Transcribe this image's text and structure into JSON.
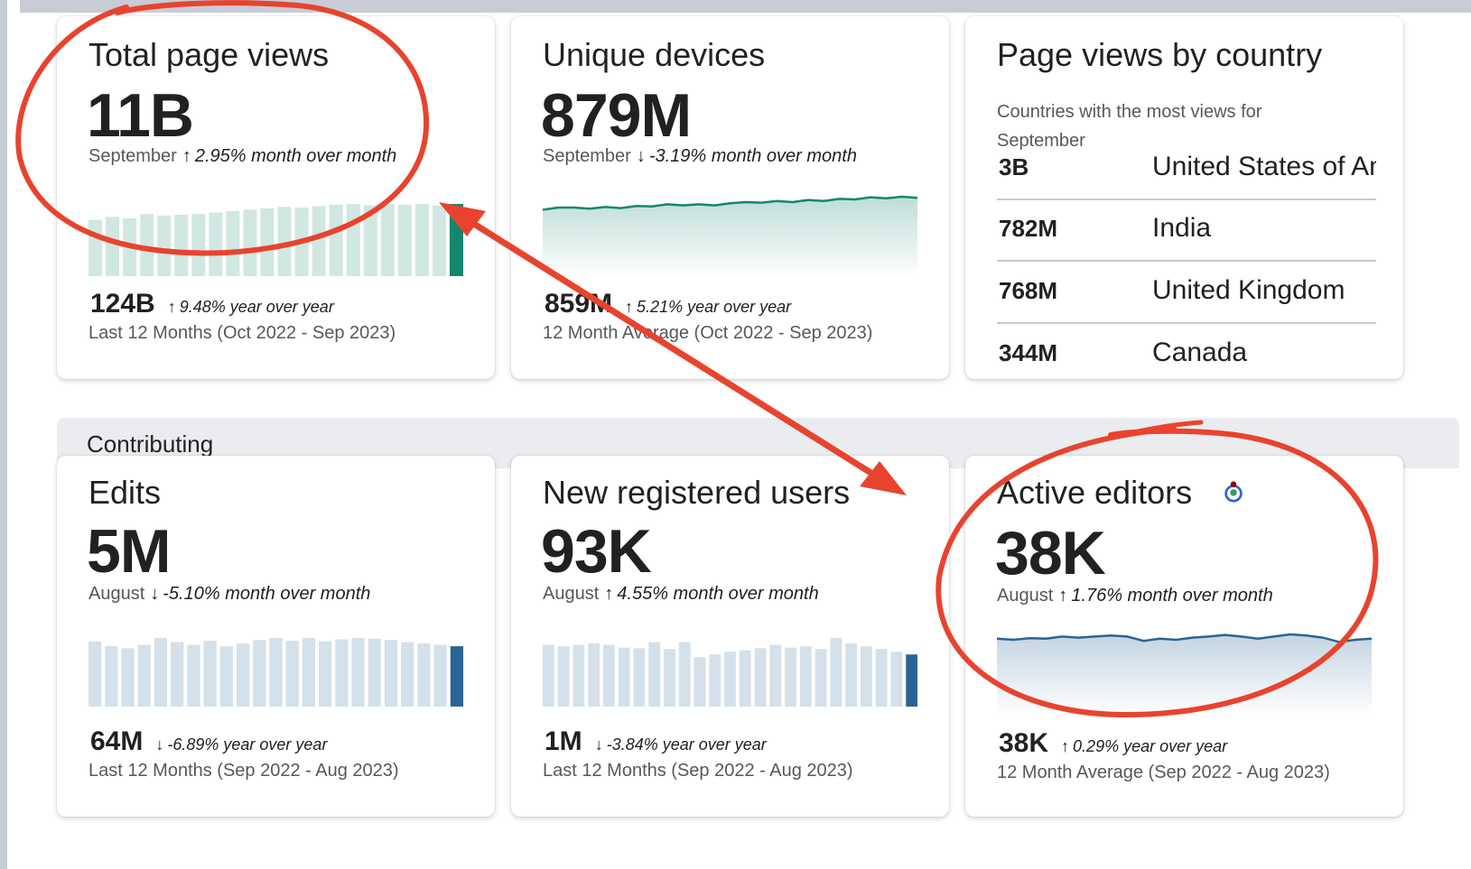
{
  "cards": {
    "page_views": {
      "title": "Total page views",
      "value": "11B",
      "period": "September",
      "change": "2.95% month over month",
      "footer_value": "124B",
      "footer_change": "9.48% year over year",
      "footer_range": "Last 12 Months (Oct 2022 - Sep 2023)",
      "color": "#14866d",
      "bars": [
        0.78,
        0.82,
        0.8,
        0.86,
        0.84,
        0.85,
        0.86,
        0.88,
        0.9,
        0.92,
        0.94,
        0.96,
        0.95,
        0.97,
        0.99,
        1.0,
        0.98,
        1.0,
        0.99,
        1.0,
        0.98,
        1.0
      ]
    },
    "devices": {
      "title": "Unique devices",
      "value": "879M",
      "period": "September",
      "change": "-3.19% month over month",
      "footer_value": "859M",
      "footer_change": "5.21% year over year",
      "footer_range": "12 Month Average (Oct 2022 - Sep 2023)",
      "color": "#14866d",
      "line": [
        0.76,
        0.8,
        0.8,
        0.78,
        0.81,
        0.79,
        0.83,
        0.82,
        0.86,
        0.84,
        0.86,
        0.84,
        0.88,
        0.9,
        0.89,
        0.92,
        0.9,
        0.94,
        0.92,
        0.96,
        0.95,
        0.99,
        0.97,
        1.0,
        0.98
      ]
    },
    "country": {
      "title": "Page views by country",
      "description": "Countries with the most views for September",
      "rows": [
        {
          "value": "3B",
          "name": "United States of America"
        },
        {
          "value": "782M",
          "name": "India"
        },
        {
          "value": "768M",
          "name": "United Kingdom"
        },
        {
          "value": "344M",
          "name": "Canada"
        }
      ]
    },
    "edits": {
      "title": "Edits",
      "value": "5M",
      "period": "August",
      "change": "-5.10% month over month",
      "footer_value": "64M",
      "footer_change": "-6.89% year over year",
      "footer_range": "Last 12 Months (Sep 2022 - Aug 2023)",
      "color": "#2a6496",
      "bars": [
        0.95,
        0.88,
        0.85,
        0.9,
        1.0,
        0.94,
        0.9,
        0.96,
        0.88,
        0.92,
        0.97,
        1.0,
        0.96,
        1.0,
        0.95,
        0.98,
        1.0,
        0.99,
        0.97,
        0.94,
        0.92,
        0.9,
        0.88
      ]
    },
    "new_users": {
      "title": "New registered users",
      "value": "93K",
      "period": "August",
      "change": "4.55% month over month",
      "footer_value": "1M",
      "footer_change": "-3.84% year over year",
      "footer_range": "Last 12 Months (Sep 2022 - Aug 2023)",
      "color": "#2a6496",
      "bars": [
        0.9,
        0.88,
        0.9,
        0.92,
        0.9,
        0.86,
        0.85,
        0.94,
        0.84,
        0.94,
        0.72,
        0.76,
        0.8,
        0.82,
        0.85,
        0.9,
        0.86,
        0.88,
        0.84,
        1.0,
        0.92,
        0.88,
        0.84,
        0.8,
        0.76
      ]
    },
    "active_editors": {
      "title": "Active editors",
      "value": "38K",
      "period": "August",
      "change": "1.76% month over month",
      "footer_value": "38K",
      "footer_change": "0.29% year over year",
      "footer_range": "12 Month Average (Sep 2022 - Aug 2023)",
      "color": "#2a6496",
      "line": [
        0.92,
        0.9,
        0.93,
        0.92,
        0.96,
        0.94,
        0.96,
        0.98,
        0.96,
        0.88,
        0.92,
        0.9,
        0.94,
        0.96,
        0.99,
        0.96,
        0.92,
        0.96,
        1.0,
        0.98,
        0.94,
        0.86,
        0.9,
        0.92
      ]
    }
  },
  "section": {
    "contributing": "Contributing"
  },
  "icons": {
    "up": "↑",
    "down": "↓",
    "logo": "wikimedia-logo-icon"
  },
  "annotation_color": "#e8432e"
}
